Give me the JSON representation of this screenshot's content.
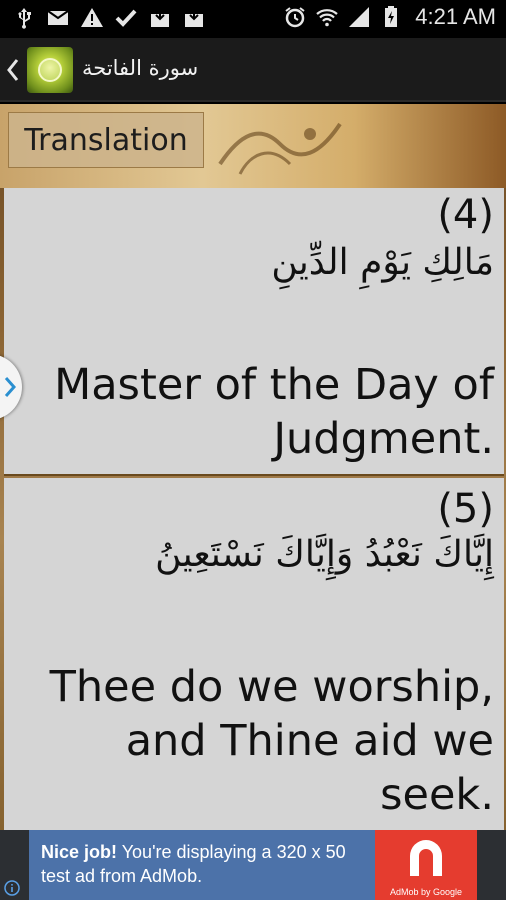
{
  "status_bar": {
    "time": "4:21 AM",
    "left_icons": [
      "usb-icon",
      "email-icon",
      "warning-icon",
      "check-icon",
      "download-icon",
      "download-icon"
    ],
    "right_icons": [
      "alarm-icon",
      "wifi-icon",
      "signal-icon",
      "battery-icon"
    ]
  },
  "action_bar": {
    "title": "سورة الفاتحة",
    "back_icon": "chevron-left-icon",
    "app_icon": "quran-app-icon"
  },
  "content": {
    "translation_button": "Translation",
    "verses": [
      {
        "number": "(4)",
        "arabic": "مَالِكِ يَوْمِ الدِّينِ",
        "translation": "Master of the Day of Judgment."
      },
      {
        "number": "(5)",
        "arabic": "إِيَّاكَ نَعْبُدُ وَإِيَّاكَ نَسْتَعِينُ",
        "translation": "Thee do we worship, and Thine aid we seek."
      }
    ]
  },
  "ad": {
    "headline": "Nice job!",
    "body": " You're displaying a 320 x 50 test ad from AdMob.",
    "logo_caption": "AdMob by Google",
    "colors": {
      "background": "#4c72a9",
      "logo": "#e53c2f"
    }
  }
}
